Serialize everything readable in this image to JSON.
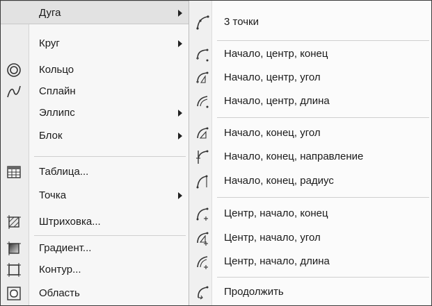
{
  "left_menu": {
    "items": [
      {
        "label": "Дуга",
        "icon": "none",
        "has_submenu": true,
        "highlighted": true
      },
      {
        "label": "Круг",
        "icon": "none",
        "has_submenu": true
      },
      {
        "label": "Кольцо",
        "icon": "donut-icon",
        "has_submenu": false
      },
      {
        "label": "Сплайн",
        "icon": "spline-icon",
        "has_submenu": false
      },
      {
        "label": "Эллипс",
        "icon": "none",
        "has_submenu": true
      },
      {
        "label": "Блок",
        "icon": "none",
        "has_submenu": true
      },
      {
        "label": "Таблица...",
        "icon": "table-icon",
        "has_submenu": false
      },
      {
        "label": "Точка",
        "icon": "none",
        "has_submenu": true
      },
      {
        "label": "Штриховка...",
        "icon": "hatch-icon",
        "has_submenu": false
      },
      {
        "label": "Градиент...",
        "icon": "gradient-icon",
        "has_submenu": false
      },
      {
        "label": "Контур...",
        "icon": "boundary-icon",
        "has_submenu": false
      },
      {
        "label": "Область",
        "icon": "region-icon",
        "has_submenu": false
      }
    ]
  },
  "arc_submenu": {
    "items": [
      {
        "label": "3 точки",
        "icon": "arc-3points-icon"
      },
      {
        "label": "Начало, центр, конец",
        "icon": "arc-start-center-end-icon"
      },
      {
        "label": "Начало, центр, угол",
        "icon": "arc-start-center-angle-icon"
      },
      {
        "label": "Начало, центр, длина",
        "icon": "arc-start-center-length-icon"
      },
      {
        "label": "Начало, конец, угол",
        "icon": "arc-start-end-angle-icon"
      },
      {
        "label": "Начало, конец, направление",
        "icon": "arc-start-end-direction-icon"
      },
      {
        "label": "Начало, конец, радиус",
        "icon": "arc-start-end-radius-icon"
      },
      {
        "label": "Центр, начало, конец",
        "icon": "arc-center-start-end-icon"
      },
      {
        "label": "Центр, начало, угол",
        "icon": "arc-center-start-angle-icon"
      },
      {
        "label": "Центр, начало, длина",
        "icon": "arc-center-start-length-icon"
      },
      {
        "label": "Продолжить",
        "icon": "arc-continue-icon"
      }
    ]
  }
}
